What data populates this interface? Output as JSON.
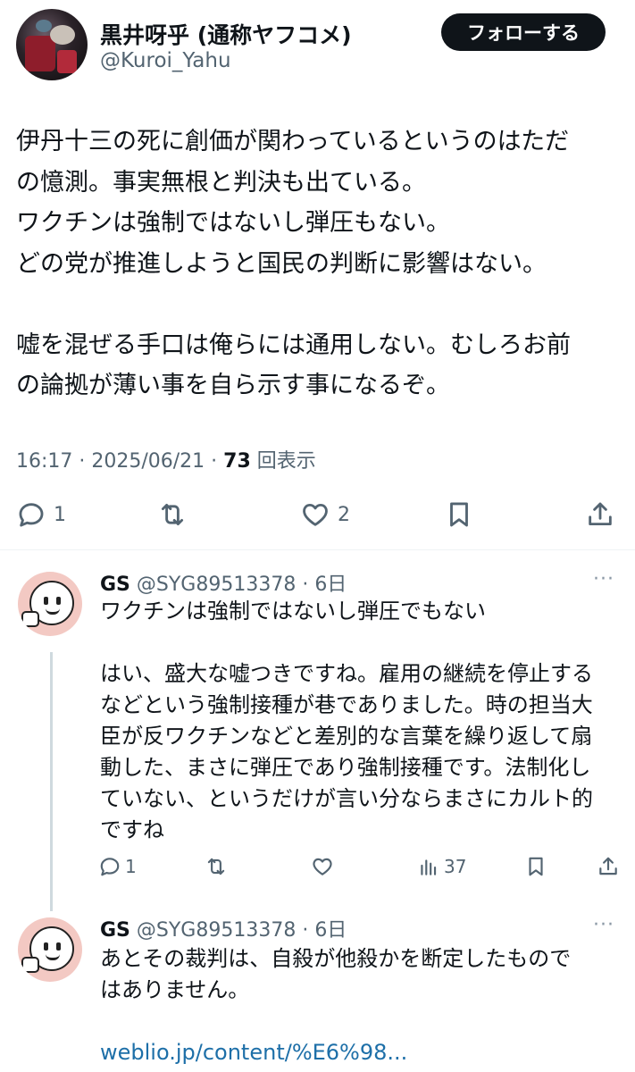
{
  "author": {
    "display_name": "黒井呀乎 (通称ヤフコメ)",
    "handle": "@Kuroi_Yahu",
    "follow_label": "フォローする"
  },
  "tweet": {
    "lines": [
      "伊丹十三の死に創価が関わっているというのはただ",
      "の憶測。事実無根と判決も出ている。",
      "ワクチンは強制ではないし弾圧もない。",
      "どの党が推進しようと国民の判断に影響はない。",
      "",
      "嘘を混ぜる手口は俺らには通用しない。むしろお前",
      "の論拠が薄い事を自ら示す事になるぞ。"
    ],
    "time": "16:17 · 2025/06/21 · ",
    "views_count": "73",
    "views_label": " 回表示",
    "reply_count": "1",
    "like_count": "2"
  },
  "replies": [
    {
      "name": "GS",
      "handle": "@SYG89513378 · 6日",
      "more": "···",
      "lines": [
        "ワクチンは強制ではないし弾圧でもない",
        "",
        "はい、盛大な嘘つきですね。雇用の継続を停止する",
        "などという強制接種が巷でありました。時の担当大",
        "臣が反ワクチンなどと差別的な言葉を繰り返して扇",
        "動した、まさに弾圧であり強制接種です。法制化し",
        "ていない、というだけが言い分ならまさにカルト的",
        "ですね"
      ],
      "reply_count": "1",
      "views_count": "37"
    },
    {
      "name": "GS",
      "handle": "@SYG89513378 · 6日",
      "more": "···",
      "lines": [
        "あとその裁判は、自殺が他殺かを断定したもので",
        "はありません。"
      ],
      "link": "weblio.jp/content/%E6%98..."
    }
  ],
  "icons": [
    "reply-icon",
    "retweet-icon",
    "like-icon",
    "bookmark-icon",
    "share-icon",
    "views-icon",
    "more-icon"
  ]
}
